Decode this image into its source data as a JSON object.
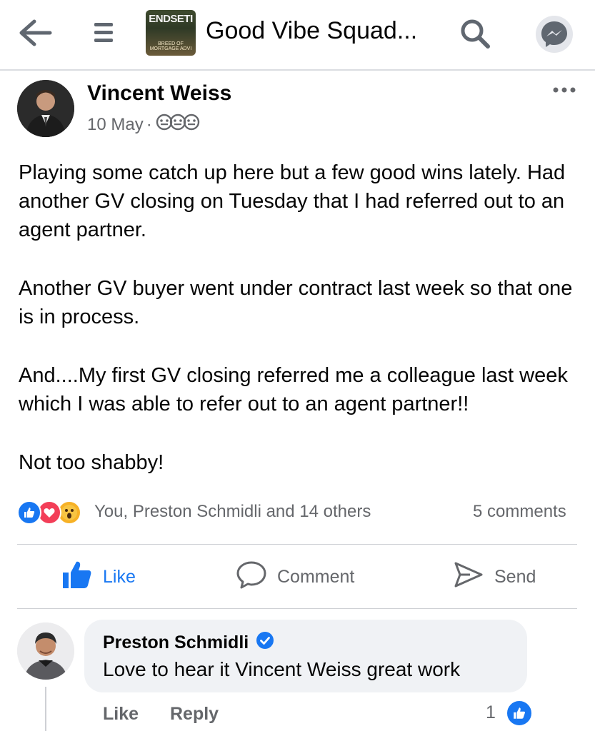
{
  "header": {
    "group_thumb_title": "ENDSETI",
    "group_thumb_subtitle": "BREED OF MORTGAGE ADVI",
    "group_name": "Good Vibe Squad..."
  },
  "post": {
    "author": "Vincent Weiss",
    "date": "10 May",
    "separator": "·",
    "audience_icon": "group-audience-icon",
    "paragraphs": [
      "Playing some catch up here but a few good wins lately.  Had another GV closing on Tuesday that I had referred out to an agent partner.",
      "Another GV buyer went under contract last week so that one is in process.",
      "And....My first GV closing referred me a colleague last week which I was able to refer out to an agent partner!!",
      "Not too shabby!"
    ],
    "reactions": {
      "icons": [
        "like-reaction-icon",
        "love-reaction-icon",
        "wow-reaction-icon"
      ],
      "names": "You, Preston Schmidli and 14 others",
      "comments": "5 comments"
    },
    "actions": {
      "like": "Like",
      "comment": "Comment",
      "send": "Send"
    }
  },
  "comment": {
    "author": "Preston Schmidli",
    "verified": true,
    "text": "Love to hear it Vincent Weiss great work",
    "like_label": "Like",
    "reply_label": "Reply",
    "like_count": "1"
  },
  "colors": {
    "accent": "#1877f2",
    "secondary_text": "#65676b",
    "bubble": "#f0f2f5",
    "divider": "#ced0d4"
  }
}
